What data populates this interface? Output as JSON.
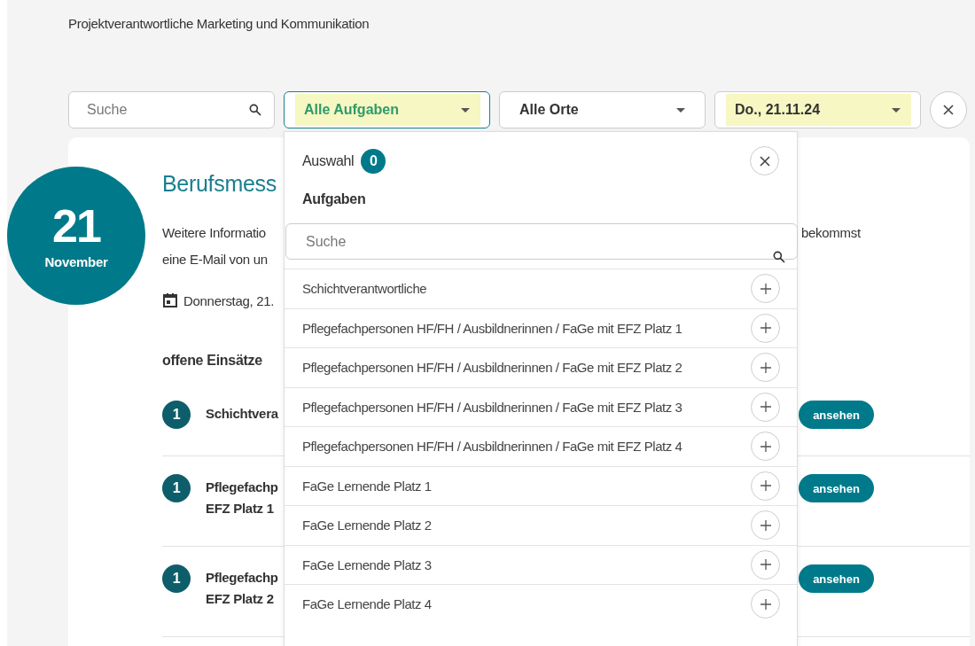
{
  "header": {
    "subtitle": "Projektverantwortliche Marketing und Kommunikation"
  },
  "filters": {
    "search": {
      "placeholder": "Suche"
    },
    "selects": [
      {
        "value": "Alle Aufgaben",
        "open": true,
        "highlighted": true
      },
      {
        "value": "Alle Orte",
        "open": false,
        "highlighted": false
      },
      {
        "value": "Do., 21.11.24",
        "open": false,
        "highlighted": true
      }
    ]
  },
  "event": {
    "day": "21",
    "month": "November",
    "title": "Berufsmess",
    "description_lines": [
      {
        "left": "Weitere Informatio",
        "right": "bekommst"
      },
      {
        "left": "eine E-Mail von un"
      }
    ],
    "date": "Donnerstag, 21.",
    "section_title": "offene Einsätze",
    "tasks": [
      {
        "count": "1",
        "lines": [
          "Schichtvera"
        ],
        "action": "ansehen"
      },
      {
        "count": "1",
        "lines": [
          "Pflegefachp",
          "EFZ Platz 1"
        ],
        "action": "ansehen"
      },
      {
        "count": "1",
        "lines": [
          "Pflegefachp",
          "EFZ Platz 2"
        ],
        "action": "ansehen"
      }
    ]
  },
  "dropdown": {
    "selection_label": "Auswahl",
    "selection_count": "0",
    "group_title": "Aufgaben",
    "search": {
      "placeholder": "Suche"
    },
    "items": [
      {
        "label": "Schichtverantwortliche"
      },
      {
        "label": "Pflegefachpersonen HF/FH / Ausbildnerinnen / FaGe mit EFZ Platz 1"
      },
      {
        "label": "Pflegefachpersonen HF/FH / Ausbildnerinnen / FaGe mit EFZ Platz 2"
      },
      {
        "label": "Pflegefachpersonen HF/FH / Ausbildnerinnen / FaGe mit EFZ Platz 3"
      },
      {
        "label": "Pflegefachpersonen HF/FH / Ausbildnerinnen / FaGe mit EFZ Platz 4"
      },
      {
        "label": "FaGe Lernende Platz 1"
      },
      {
        "label": "FaGe Lernende Platz 2"
      },
      {
        "label": "FaGe Lernende Platz 3"
      },
      {
        "label": "FaGe Lernende Platz 4"
      }
    ]
  }
}
